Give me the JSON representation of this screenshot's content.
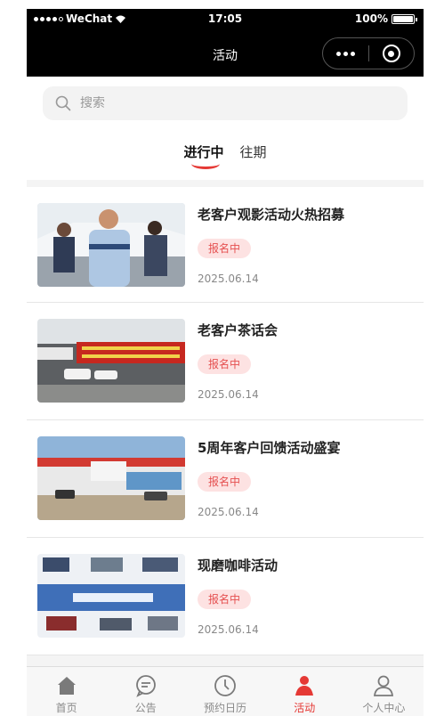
{
  "status_bar": {
    "carrier": "WeChat",
    "time": "17:05",
    "battery": "100%",
    "battery_level": 1.0
  },
  "nav": {
    "title": "活动"
  },
  "search": {
    "placeholder": "搜索"
  },
  "tabs": [
    {
      "label": "进行中",
      "active": true
    },
    {
      "label": "往期",
      "active": false
    }
  ],
  "activities": [
    {
      "title": "老客户观影活动火热招募",
      "status": "报名中",
      "date": "2025.06.14"
    },
    {
      "title": "老客户茶话会",
      "status": "报名中",
      "date": "2025.06.14"
    },
    {
      "title": "5周年客户回馈活动盛宴",
      "status": "报名中",
      "date": "2025.06.14"
    },
    {
      "title": "现磨咖啡活动",
      "status": "报名中",
      "date": "2025.06.14"
    }
  ],
  "tab_bar": [
    {
      "label": "首页",
      "icon": "home-icon"
    },
    {
      "label": "公告",
      "icon": "message-icon"
    },
    {
      "label": "预约日历",
      "icon": "clock-icon"
    },
    {
      "label": "活动",
      "icon": "activity-icon",
      "active": true
    },
    {
      "label": "个人中心",
      "icon": "user-icon"
    }
  ],
  "colors": {
    "accent": "#e53935",
    "badge_bg": "#fde2e2",
    "badge_text": "#e55050",
    "header_bg": "#000000"
  }
}
